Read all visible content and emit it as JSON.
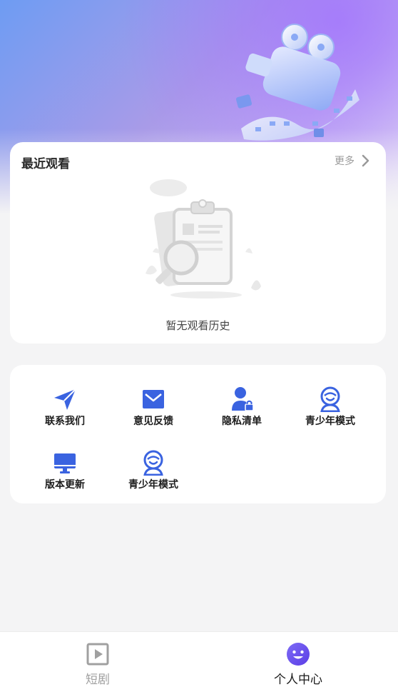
{
  "recent": {
    "title": "最近观看",
    "more_label": "更多",
    "empty_text": "暂无观看历史"
  },
  "menu": {
    "items": [
      {
        "label": "联系我们",
        "icon": "send-icon"
      },
      {
        "label": "意见反馈",
        "icon": "mail-icon"
      },
      {
        "label": "隐私清单",
        "icon": "user-lock-icon"
      },
      {
        "label": "青少年模式",
        "icon": "child-icon"
      },
      {
        "label": "版本更新",
        "icon": "monitor-icon"
      },
      {
        "label": "青少年模式",
        "icon": "child-icon"
      }
    ]
  },
  "tabbar": {
    "tabs": [
      {
        "label": "短剧",
        "icon": "play-square-icon",
        "active": false
      },
      {
        "label": "个人中心",
        "icon": "smiley-icon",
        "active": true
      }
    ]
  },
  "colors": {
    "accent": "#3a63e0",
    "active_tab": "#6a4cf0",
    "inactive": "#a0a0a0"
  }
}
